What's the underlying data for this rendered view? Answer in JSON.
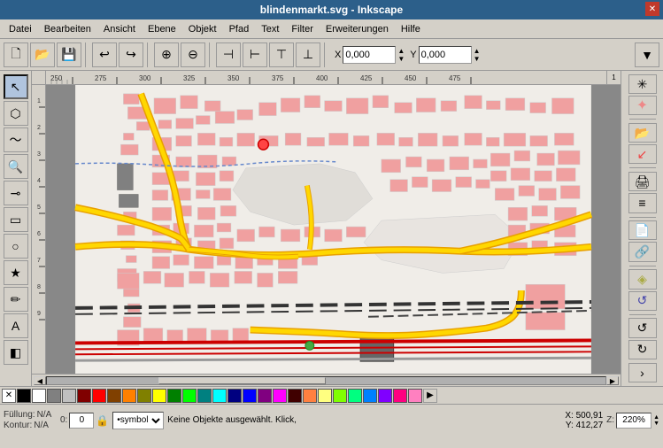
{
  "titlebar": {
    "title": "blindenmarkt.svg - Inkscape",
    "close_label": "✕"
  },
  "menubar": {
    "items": [
      "Datei",
      "Bearbeiten",
      "Ansicht",
      "Ebene",
      "Objekt",
      "Pfad",
      "Text",
      "Filter",
      "Erweiterungen",
      "Hilfe"
    ]
  },
  "toolbar": {
    "coord_x_label": "X",
    "coord_y_label": "Y",
    "x_value": "0,000",
    "y_value": "0,000"
  },
  "left_tools": {
    "tools": [
      {
        "name": "select-tool",
        "icon": "↖",
        "active": true
      },
      {
        "name": "node-tool",
        "icon": "⬡"
      },
      {
        "name": "tweak-tool",
        "icon": "~"
      },
      {
        "name": "zoom-tool",
        "icon": "🔍"
      },
      {
        "name": "measure-tool",
        "icon": "📏"
      },
      {
        "name": "rect-tool",
        "icon": "▭"
      },
      {
        "name": "circle-tool",
        "icon": "○"
      },
      {
        "name": "star-tool",
        "icon": "★"
      },
      {
        "name": "pencil-tool",
        "icon": "✏"
      },
      {
        "name": "text-tool",
        "icon": "A"
      },
      {
        "name": "gradient-tool",
        "icon": "◧"
      }
    ]
  },
  "right_panel": {
    "buttons": [
      {
        "name": "xml-editor",
        "icon": "<>"
      },
      {
        "name": "layers",
        "icon": "≡"
      },
      {
        "name": "object-props",
        "icon": "i"
      },
      {
        "name": "fill-stroke",
        "icon": "▣"
      },
      {
        "name": "snap",
        "icon": "%"
      },
      {
        "name": "align",
        "icon": "⊞"
      },
      {
        "name": "transform",
        "icon": "↻"
      },
      {
        "name": "chevron-right",
        "icon": "›"
      },
      {
        "name": "undo",
        "icon": "↺"
      },
      {
        "name": "redo",
        "icon": "↻"
      }
    ]
  },
  "bottom_bar": {
    "fill_label": "Füllung:",
    "fill_value": "N/A",
    "kontur_label": "Kontur:",
    "kontur_value": "N/A",
    "opacity_value": "0",
    "lock_icon": "🔒",
    "symbol_value": "•symbol",
    "status_text": "Keine Objekte ausgewählt. Klick,",
    "x_coord": "X: 500,91",
    "y_coord": "Y: 412,27",
    "zoom_label": "Z:",
    "zoom_value": "220%"
  },
  "palette": {
    "colors": [
      "#000000",
      "#ffffff",
      "#808080",
      "#c0c0c0",
      "#800000",
      "#ff0000",
      "#804000",
      "#ff8000",
      "#808000",
      "#ffff00",
      "#008000",
      "#00ff00",
      "#008080",
      "#00ffff",
      "#000080",
      "#0000ff",
      "#800080",
      "#ff00ff",
      "#400000",
      "#804040",
      "#ff8040",
      "#ffff80",
      "#80ff00",
      "#00ff80",
      "#0080ff",
      "#8000ff",
      "#ff0080",
      "#ff80c0",
      "#ffffff"
    ]
  }
}
